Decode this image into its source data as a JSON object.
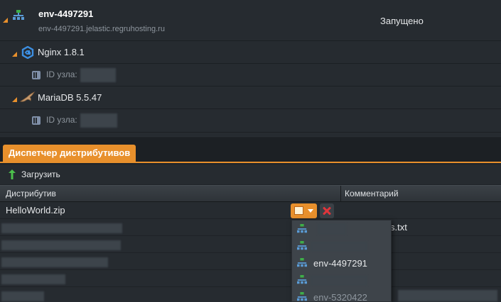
{
  "environment": {
    "name": "env-4497291",
    "url": "env-4497291.jelastic.regruhosting.ru",
    "status": "Запущено",
    "icon": "environment-topology-icon"
  },
  "nodes": [
    {
      "name": "Nginx 1.8.1",
      "icon": "nginx-icon",
      "id_label": "ID узла:"
    },
    {
      "name": "MariaDB 5.5.47",
      "icon": "mariadb-icon",
      "id_label": "ID узла:"
    }
  ],
  "deployment_manager": {
    "tab_label": "Диспетчер дистрибутивов",
    "upload_label": "Загрузить",
    "columns": [
      "Дистрибутив",
      "Комментарий"
    ],
    "rows": [
      {
        "name": "HelloWorld.zip",
        "comment": ""
      },
      {
        "name": "",
        "comment": "s.txt"
      }
    ]
  },
  "deploy_menu": {
    "items": [
      {
        "label": ""
      },
      {
        "label": ""
      },
      {
        "label": "env-4497291"
      },
      {
        "label": ""
      },
      {
        "label": "env-5320422"
      }
    ]
  },
  "colors": {
    "accent": "#e8902c",
    "delete": "#e0353b",
    "background": "#262b30"
  }
}
